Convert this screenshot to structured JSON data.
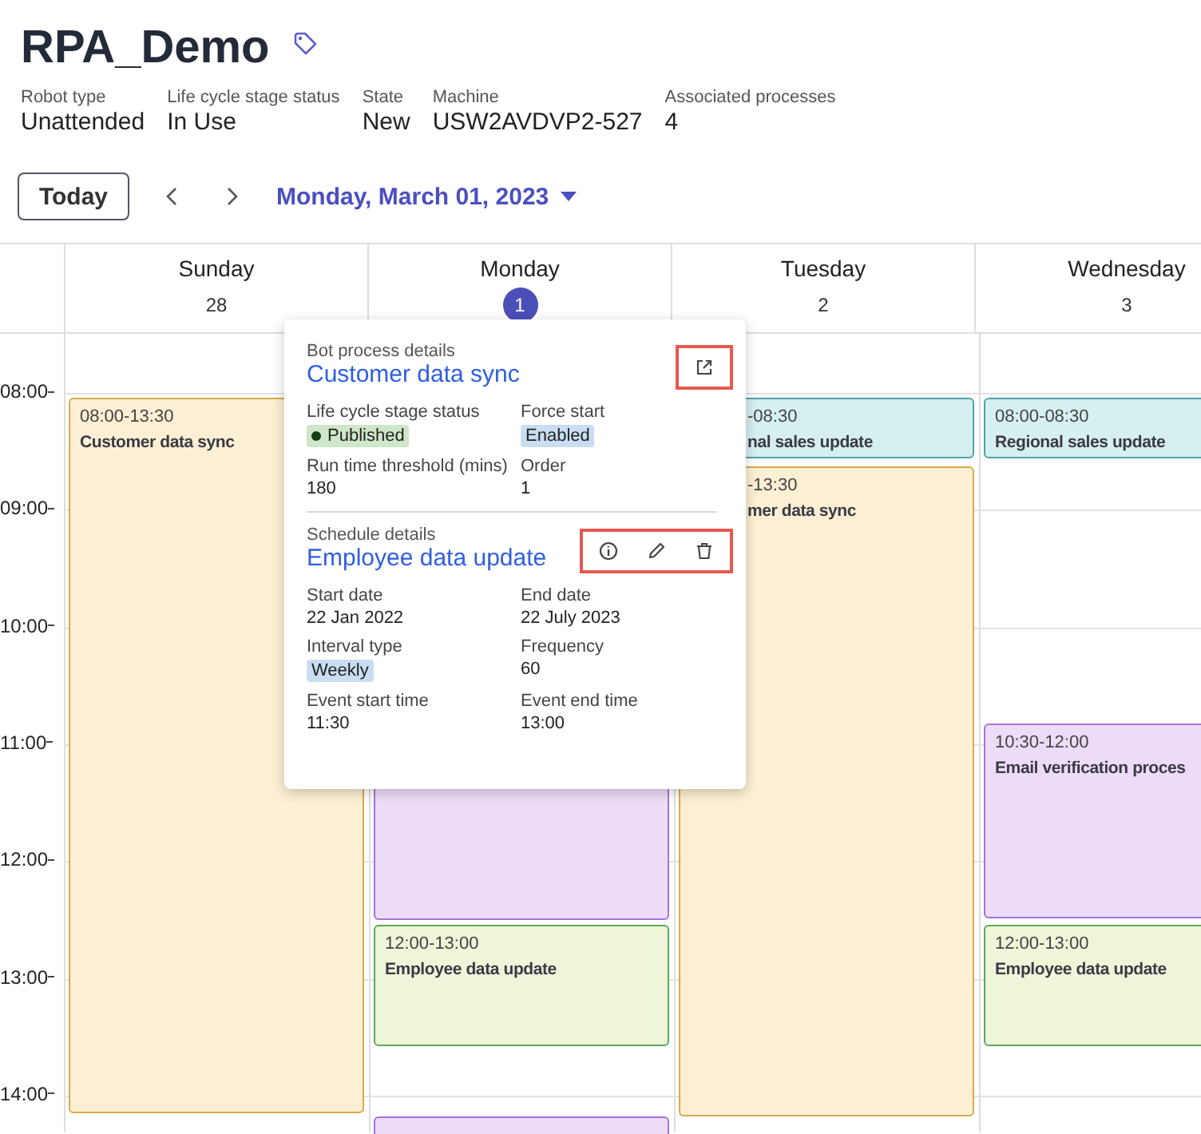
{
  "title": "RPA_Demo",
  "properties": [
    {
      "label": "Robot type",
      "value": "Unattended"
    },
    {
      "label": "Life cycle stage status",
      "value": "In Use"
    },
    {
      "label": "State",
      "value": "New"
    },
    {
      "label": "Machine",
      "value": "USW2AVDVP2-527"
    },
    {
      "label": "Associated processes",
      "value": "4"
    }
  ],
  "toolbar": {
    "today_button": "Today",
    "date": "Monday, March 01, 2023"
  },
  "calendar": {
    "time_labels": [
      "08:00",
      "09:00",
      "10:00",
      "11:00",
      "12:00",
      "13:00",
      "14:00"
    ],
    "days": [
      {
        "name": "Sunday",
        "date": "28",
        "selected": false,
        "events": [
          {
            "time": "08:00-13:30",
            "title": "Customer data sync",
            "color": "#fdefd3"
          }
        ]
      },
      {
        "name": "Monday",
        "date": "1",
        "selected": true,
        "events": [
          {
            "color": "#ecdcf7"
          },
          {
            "time": "12:00-13:00",
            "title": "Employee data update",
            "color": "#eef5d9"
          },
          {
            "color": "#ecdcf7"
          }
        ]
      },
      {
        "name": "Tuesday",
        "date": "2",
        "selected": false,
        "events": [
          {
            "time": "-08:30",
            "title": "nal sales update",
            "color": "#d6eff0"
          },
          {
            "time": "-13:30",
            "title": "mer data sync",
            "color": "#fdefd3"
          }
        ]
      },
      {
        "name": "Wednesday",
        "date": "3",
        "selected": false,
        "events": [
          {
            "time": "08:00-08:30",
            "title": "Regional sales update",
            "color": "#d6eff0"
          },
          {
            "time": "10:30-12:00",
            "title": "Email verification proces",
            "color": "#ecdcf7"
          },
          {
            "time": "12:00-13:00",
            "title": "Employee data update",
            "color": "#eef5d9"
          }
        ]
      }
    ]
  },
  "popover": {
    "sections": [
      {
        "heading": "Bot process details",
        "name": "Customer data sync",
        "actions": [
          {
            "kind": "open"
          }
        ],
        "fields": [
          {
            "label": "Life cycle stage status",
            "value": "Published",
            "kind": "status"
          },
          {
            "label": "Force start",
            "value": "Enabled",
            "kind": "tag"
          },
          {
            "label": "Run time threshold (mins)",
            "value": "180",
            "kind": "text"
          },
          {
            "label": "Order",
            "value": "1",
            "kind": "text"
          }
        ]
      },
      {
        "heading": "Schedule details",
        "name": "Employee data update",
        "actions": [
          {
            "kind": "info"
          },
          {
            "kind": "edit"
          },
          {
            "kind": "delete"
          }
        ],
        "fields": [
          {
            "label": "Start date",
            "value": "22 Jan 2022",
            "kind": "text"
          },
          {
            "label": "End date",
            "value": "22 July 2023",
            "kind": "text"
          },
          {
            "label": "Interval type",
            "value": "Weekly",
            "kind": "tag"
          },
          {
            "label": "Frequency",
            "value": "60",
            "kind": "text"
          },
          {
            "label": "Event start time",
            "value": "11:30",
            "kind": "text"
          },
          {
            "label": "Event end time",
            "value": "13:00",
            "kind": "text"
          }
        ]
      }
    ]
  }
}
